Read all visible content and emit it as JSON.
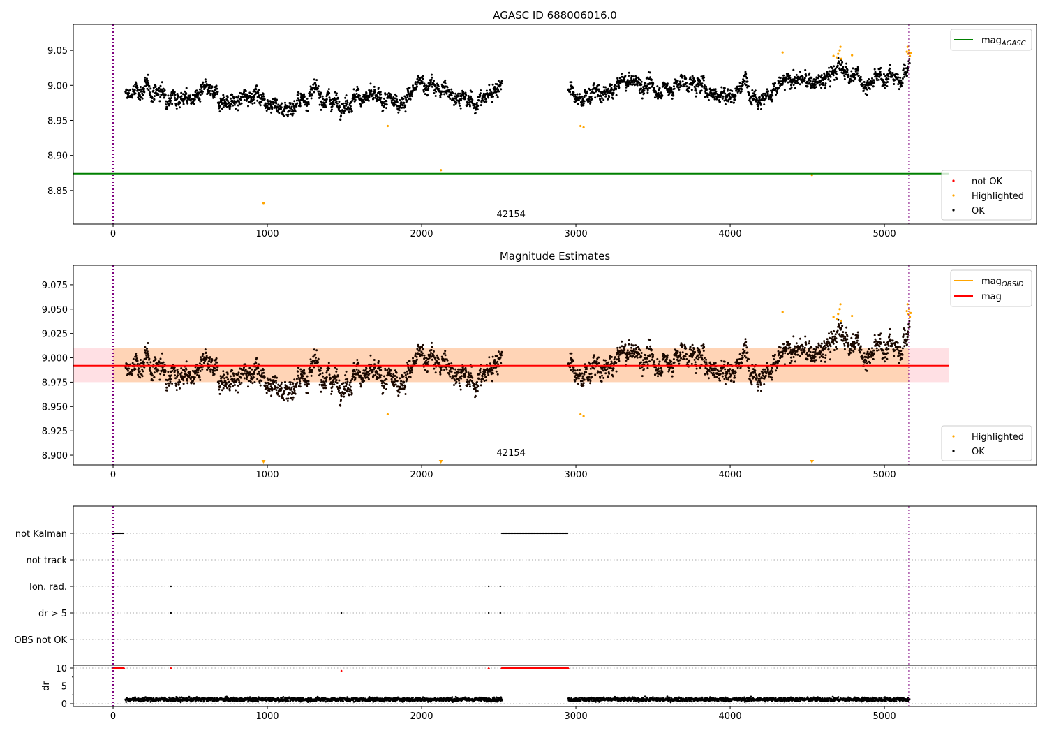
{
  "chart_data": [
    {
      "type": "scatter",
      "title": "AGASC ID 688006016.0",
      "xlim": [
        -258,
        5986
      ],
      "ylim": [
        8.802,
        9.087
      ],
      "xticks": [
        0,
        1000,
        2000,
        3000,
        4000,
        5000
      ],
      "yticks": [
        "8.85",
        "8.90",
        "8.95",
        "9.00",
        "9.05"
      ],
      "mag_agasc": 8.874,
      "annotation": {
        "text": "42154",
        "x": 2580,
        "y": 8.81
      },
      "vlines": [
        0,
        5160
      ],
      "legend_upper": [
        {
          "label": "mag",
          "sub": "AGASC",
          "color": "#008000"
        }
      ],
      "legend_lower": [
        {
          "label": "not OK",
          "color": "#ff0000"
        },
        {
          "label": "Highlighted",
          "color": "#ffa500"
        },
        {
          "label": "OK",
          "color": "#000000"
        }
      ]
    },
    {
      "type": "scatter",
      "title": "Magnitude Estimates",
      "xlim": [
        -258,
        5986
      ],
      "ylim": [
        8.89,
        9.095
      ],
      "xticks": [
        0,
        1000,
        2000,
        3000,
        4000,
        5000
      ],
      "yticks": [
        "8.900",
        "8.925",
        "8.950",
        "8.975",
        "9.000",
        "9.025",
        "9.050",
        "9.075"
      ],
      "mag": 8.992,
      "mag_band": [
        8.975,
        9.01
      ],
      "mag_obsid_band_range": [
        0,
        5160
      ],
      "mag_band_range": [
        -258,
        5420
      ],
      "annotation": {
        "text": "42154",
        "x": 2580,
        "y": 8.898
      },
      "vlines": [
        0,
        5160
      ],
      "legend_upper": [
        {
          "label": "mag",
          "sub": "OBSID",
          "color": "#ffa500"
        },
        {
          "label": "mag",
          "sub": "",
          "color": "#ff0000"
        }
      ],
      "legend_lower": [
        {
          "label": "Highlighted",
          "color": "#ffa500"
        },
        {
          "label": "OK",
          "color": "#000000"
        }
      ]
    },
    {
      "type": "scatter",
      "flag_labels": [
        "not Kalman",
        "not track",
        "Ion. rad.",
        "dr > 5",
        "OBS not OK"
      ],
      "dr_ylabel": "dr",
      "dr_yticks": [
        "0",
        "5",
        "10"
      ],
      "dr_ylim": [
        -0.5,
        10.8
      ],
      "xticks": [
        0,
        1000,
        2000,
        3000,
        4000,
        5000
      ],
      "flags": {
        "not Kalman": [
          [
            0,
            70
          ],
          [
            2520,
            2950
          ]
        ],
        "not track": [],
        "Ion. rad.": [
          375,
          2435,
          2510
        ],
        "dr > 5": [
          375,
          1480,
          2435,
          2510
        ],
        "OBS not OK": []
      },
      "dr_high": [
        [
          0,
          70
        ],
        [
          375,
          375
        ],
        [
          2435,
          2435
        ],
        [
          2520,
          2950
        ]
      ],
      "dr_mid_point": {
        "x": 1480,
        "y": 9.2
      },
      "dr_level": 1.2
    }
  ],
  "series": {
    "segments": [
      [
        80,
        2520
      ],
      [
        2950,
        5165
      ]
    ],
    "trend_t": [
      80,
      200,
      300,
      400,
      500,
      600,
      700,
      800,
      900,
      1000,
      1100,
      1200,
      1300,
      1400,
      1500,
      1600,
      1700,
      1800,
      1900,
      2000,
      2100,
      2200,
      2300,
      2400,
      2520,
      2950,
      3000,
      3100,
      3200,
      3300,
      3400,
      3500,
      3600,
      3700,
      3800,
      3900,
      4000,
      4100,
      4200,
      4300,
      4400,
      4500,
      4600,
      4700,
      4800,
      4900,
      5000,
      5100,
      5165
    ],
    "trend_mag": [
      8.985,
      8.995,
      8.99,
      8.985,
      8.98,
      8.99,
      8.98,
      8.975,
      8.99,
      8.98,
      8.965,
      8.975,
      8.99,
      8.98,
      8.975,
      8.985,
      8.98,
      8.975,
      8.98,
      9.005,
      8.995,
      8.99,
      8.975,
      8.98,
      9.005,
      9.0,
      8.975,
      8.99,
      8.985,
      9.005,
      9.005,
      8.995,
      8.995,
      9.005,
      9.0,
      8.99,
      8.985,
      9.005,
      8.98,
      8.995,
      9.01,
      9.005,
      9.005,
      9.025,
      9.015,
      9.0,
      9.015,
      9.01,
      9.03
    ],
    "noise": 0.013,
    "highlighted": [
      [
        975,
        8.832
      ],
      [
        1780,
        8.942
      ],
      [
        2125,
        8.879
      ],
      [
        3030,
        8.942
      ],
      [
        3050,
        8.94
      ],
      [
        4340,
        9.047
      ],
      [
        4530,
        8.872
      ],
      [
        4670,
        9.042
      ],
      [
        4690,
        9.04
      ],
      [
        4700,
        9.045
      ],
      [
        4710,
        9.05
      ],
      [
        4715,
        9.055
      ],
      [
        4720,
        9.038
      ],
      [
        4790,
        9.043
      ],
      [
        5145,
        9.048
      ],
      [
        5150,
        9.055
      ],
      [
        5155,
        9.045
      ],
      [
        5160,
        9.05
      ],
      [
        5165,
        9.042
      ],
      [
        5170,
        9.046
      ]
    ]
  }
}
